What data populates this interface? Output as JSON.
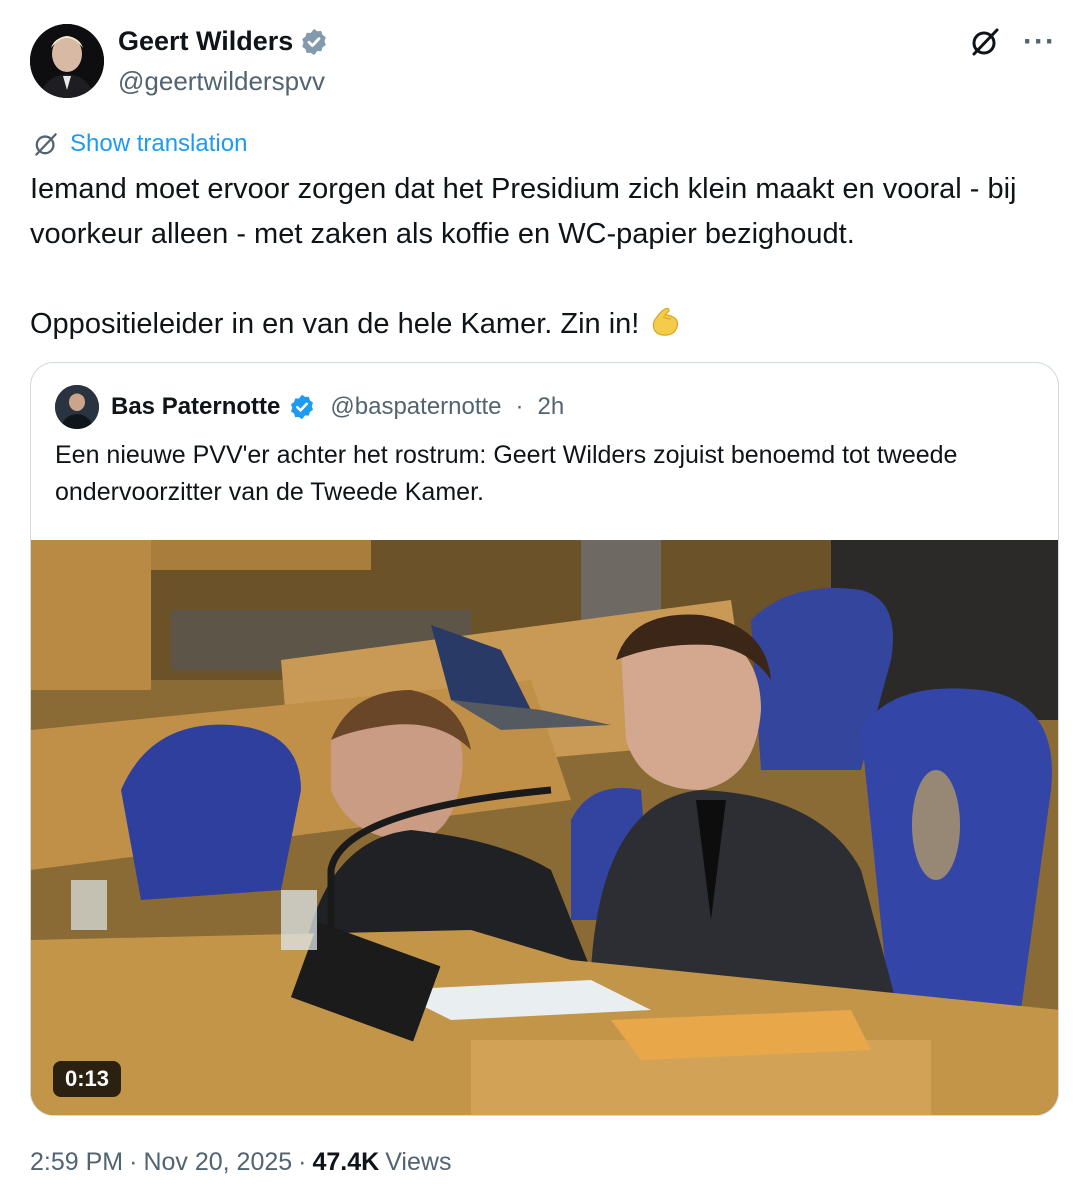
{
  "author": {
    "display_name": "Geert Wilders",
    "handle": "@geertwilderspvv",
    "verified_color": "#829aab"
  },
  "actions": {
    "grok_icon": "grok-icon",
    "more_label": "···"
  },
  "translate": {
    "label": "Show translation"
  },
  "tweet": {
    "paragraph_1": "Iemand moet ervoor zorgen dat het Presidium zich klein maakt en vooral - bij voorkeur alleen - met zaken als koffie en WC-papier bezighoudt.",
    "paragraph_2": "Oppositieleider in en van de hele Kamer. Zin in!",
    "emoji": "flexed-biceps"
  },
  "quote": {
    "display_name": "Bas Paternotte",
    "handle": "@baspaternotte",
    "separator": "·",
    "time": "2h",
    "verified_color": "#1d9bf0",
    "text": "Een nieuwe PVV'er achter het rostrum: Geert Wilders zojuist benoemd tot tweede ondervoorzitter van de Tweede Kamer.",
    "video_duration": "0:13"
  },
  "meta": {
    "time": "2:59 PM",
    "separator_1": "·",
    "date": "Nov 20, 2025",
    "separator_2": "·",
    "views_count": "47.4K",
    "views_label": "Views"
  },
  "colors": {
    "link": "#1d9bf0",
    "secondary_text": "#536471",
    "border": "#cfd9de"
  }
}
